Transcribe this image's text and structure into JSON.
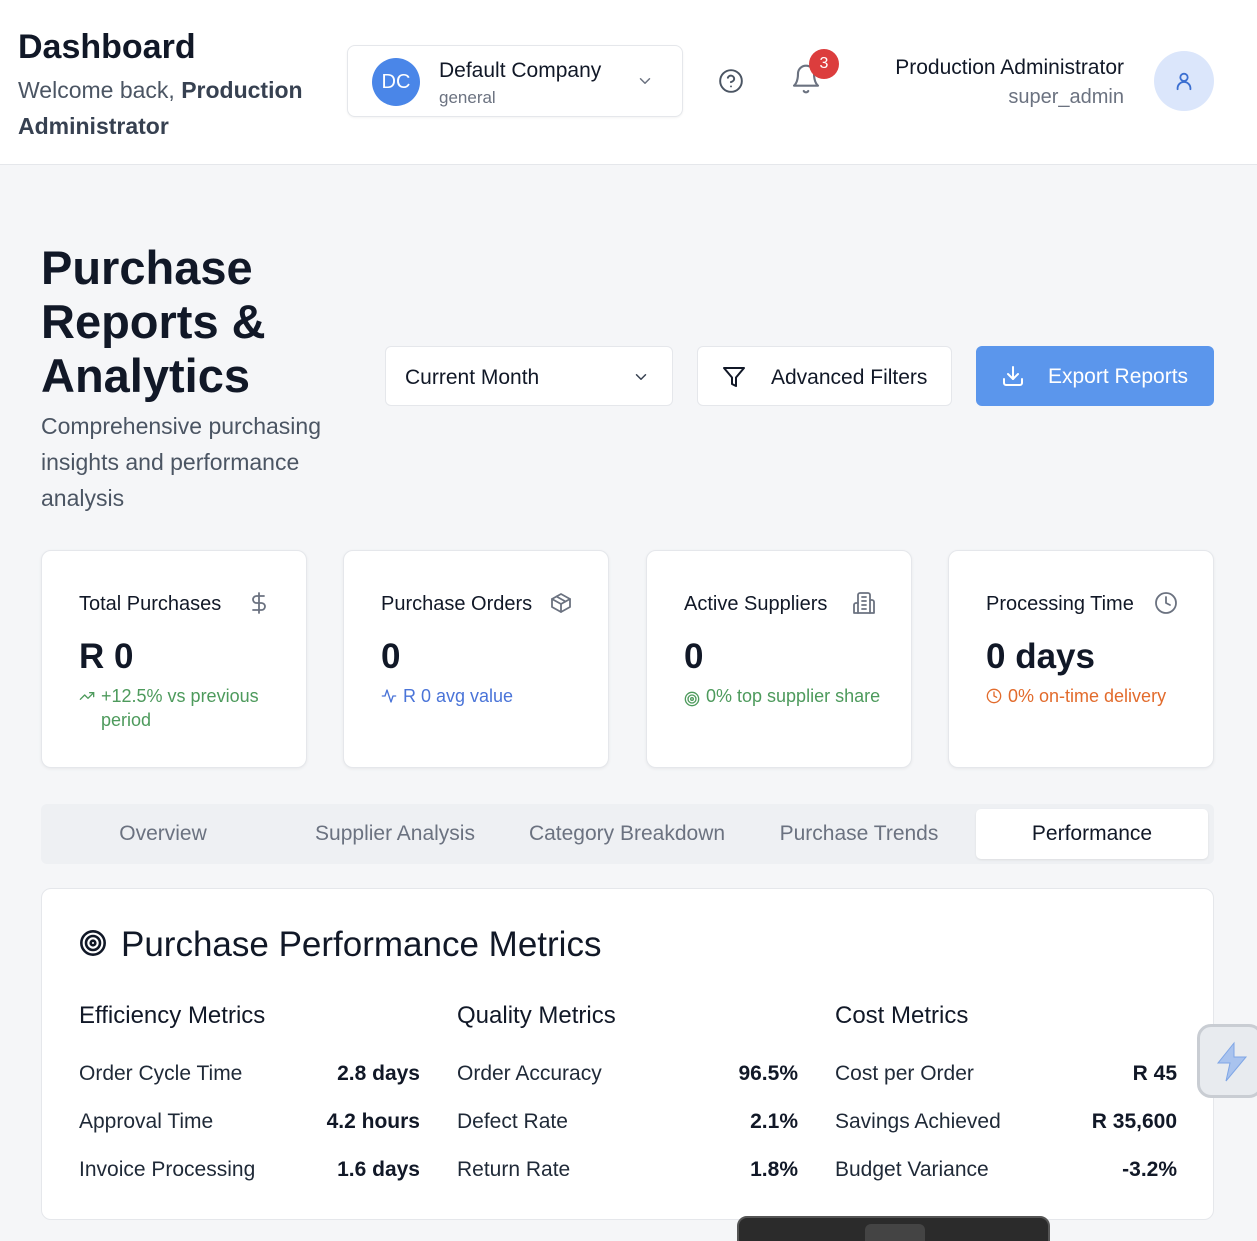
{
  "header": {
    "title": "Dashboard",
    "welcome_prefix": "Welcome back, ",
    "welcome_name": "Production Administrator",
    "company": {
      "initials": "DC",
      "name": "Default Company",
      "type": "general"
    },
    "notifications_count": "3",
    "user": {
      "name": "Production Administrator",
      "role": "super_admin"
    }
  },
  "page": {
    "title": "Purchase Reports & Analytics",
    "subtitle": "Comprehensive purchasing insights and performance analysis",
    "period_select": "Current Month",
    "filters_label": "Advanced Filters",
    "export_label": "Export Reports"
  },
  "cards": [
    {
      "title": "Total Purchases",
      "value": "R 0",
      "sub": "+12.5% vs previous period",
      "icon": "dollar-icon",
      "sub_icon": "trending-up-icon",
      "sub_color": "#4d9a5c"
    },
    {
      "title": "Purchase Orders",
      "value": "0",
      "sub": "R 0 avg value",
      "icon": "package-icon",
      "sub_icon": "activity-icon",
      "sub_color": "#4a74d8"
    },
    {
      "title": "Active Suppliers",
      "value": "0",
      "sub": "0% top supplier share",
      "icon": "building-icon",
      "sub_icon": "target-icon",
      "sub_color": "#4d9a5c"
    },
    {
      "title": "Processing Time",
      "value": "0 days",
      "sub": "0% on-time delivery",
      "icon": "clock-icon",
      "sub_icon": "clock-icon",
      "sub_color": "#e26b2c"
    }
  ],
  "tabs": [
    "Overview",
    "Supplier Analysis",
    "Category Breakdown",
    "Purchase Trends",
    "Performance"
  ],
  "active_tab": "Performance",
  "metrics": {
    "title": "Purchase Performance Metrics",
    "groups": [
      {
        "heading": "Efficiency Metrics",
        "rows": [
          {
            "label": "Order Cycle Time",
            "value": "2.8 days"
          },
          {
            "label": "Approval Time",
            "value": "4.2 hours"
          },
          {
            "label": "Invoice Processing",
            "value": "1.6 days"
          }
        ]
      },
      {
        "heading": "Quality Metrics",
        "rows": [
          {
            "label": "Order Accuracy",
            "value": "96.5%"
          },
          {
            "label": "Defect Rate",
            "value": "2.1%"
          },
          {
            "label": "Return Rate",
            "value": "1.8%"
          }
        ]
      },
      {
        "heading": "Cost Metrics",
        "rows": [
          {
            "label": "Cost per Order",
            "value": "R 45"
          },
          {
            "label": "Savings Achieved",
            "value": "R 35,600"
          },
          {
            "label": "Budget Variance",
            "value": "-3.2%"
          }
        ]
      }
    ]
  },
  "colors": {
    "accent": "#5b96ec",
    "avatar": "#4a86e8",
    "badge": "#dc3d3d"
  }
}
